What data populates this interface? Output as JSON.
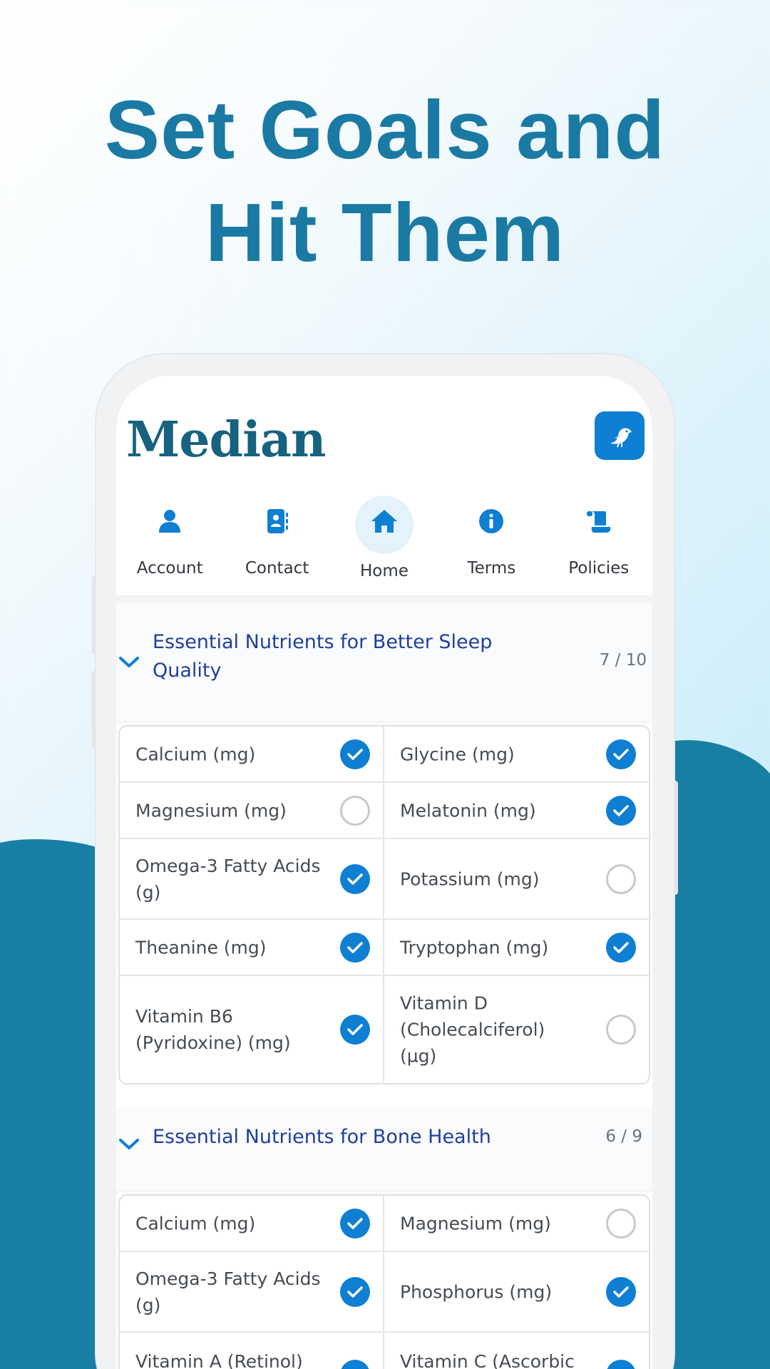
{
  "headline": {
    "line1": "Set Goals and",
    "line2": "Hit Them"
  },
  "colors": {
    "brand": "#1a7aa3",
    "accent": "#0e7fd3",
    "wave": "#177fa4",
    "section_title": "#20409a"
  },
  "app": {
    "logo": "Median",
    "header_button_icon": "bird-icon"
  },
  "nav": [
    {
      "label": "Account",
      "icon": "person-icon"
    },
    {
      "label": "Contact",
      "icon": "contact-book-icon"
    },
    {
      "label": "Home",
      "icon": "home-icon",
      "active": true
    },
    {
      "label": "Terms",
      "icon": "info-icon"
    },
    {
      "label": "Policies",
      "icon": "scroll-icon"
    }
  ],
  "sections": [
    {
      "title": "Essential Nutrients for Better Sleep Quality",
      "count": "7 / 10",
      "expanded": true,
      "rows": [
        [
          {
            "label": "Calcium (mg)",
            "checked": true
          },
          {
            "label": "Glycine (mg)",
            "checked": true
          }
        ],
        [
          {
            "label": "Magnesium (mg)",
            "checked": false
          },
          {
            "label": "Melatonin (mg)",
            "checked": true
          }
        ],
        [
          {
            "label": "Omega-3 Fatty Acids (g)",
            "checked": true
          },
          {
            "label": "Potassium (mg)",
            "checked": false
          }
        ],
        [
          {
            "label": "Theanine (mg)",
            "checked": true
          },
          {
            "label": "Tryptophan (mg)",
            "checked": true
          }
        ],
        [
          {
            "label": "Vitamin B6 (Pyridoxine) (mg)",
            "checked": true
          },
          {
            "label": "Vitamin D (Cholecalciferol) (µg)",
            "checked": false
          }
        ]
      ]
    },
    {
      "title": "Essential Nutrients for Bone Health",
      "count": "6 / 9",
      "expanded": true,
      "rows": [
        [
          {
            "label": "Calcium (mg)",
            "checked": true
          },
          {
            "label": "Magnesium (mg)",
            "checked": false
          }
        ],
        [
          {
            "label": "Omega-3 Fatty Acids (g)",
            "checked": true
          },
          {
            "label": "Phosphorus (mg)",
            "checked": true
          }
        ],
        [
          {
            "label": "Vitamin A (Retinol)",
            "checked": true
          },
          {
            "label": "Vitamin C (Ascorbic",
            "checked": true
          }
        ]
      ]
    }
  ]
}
